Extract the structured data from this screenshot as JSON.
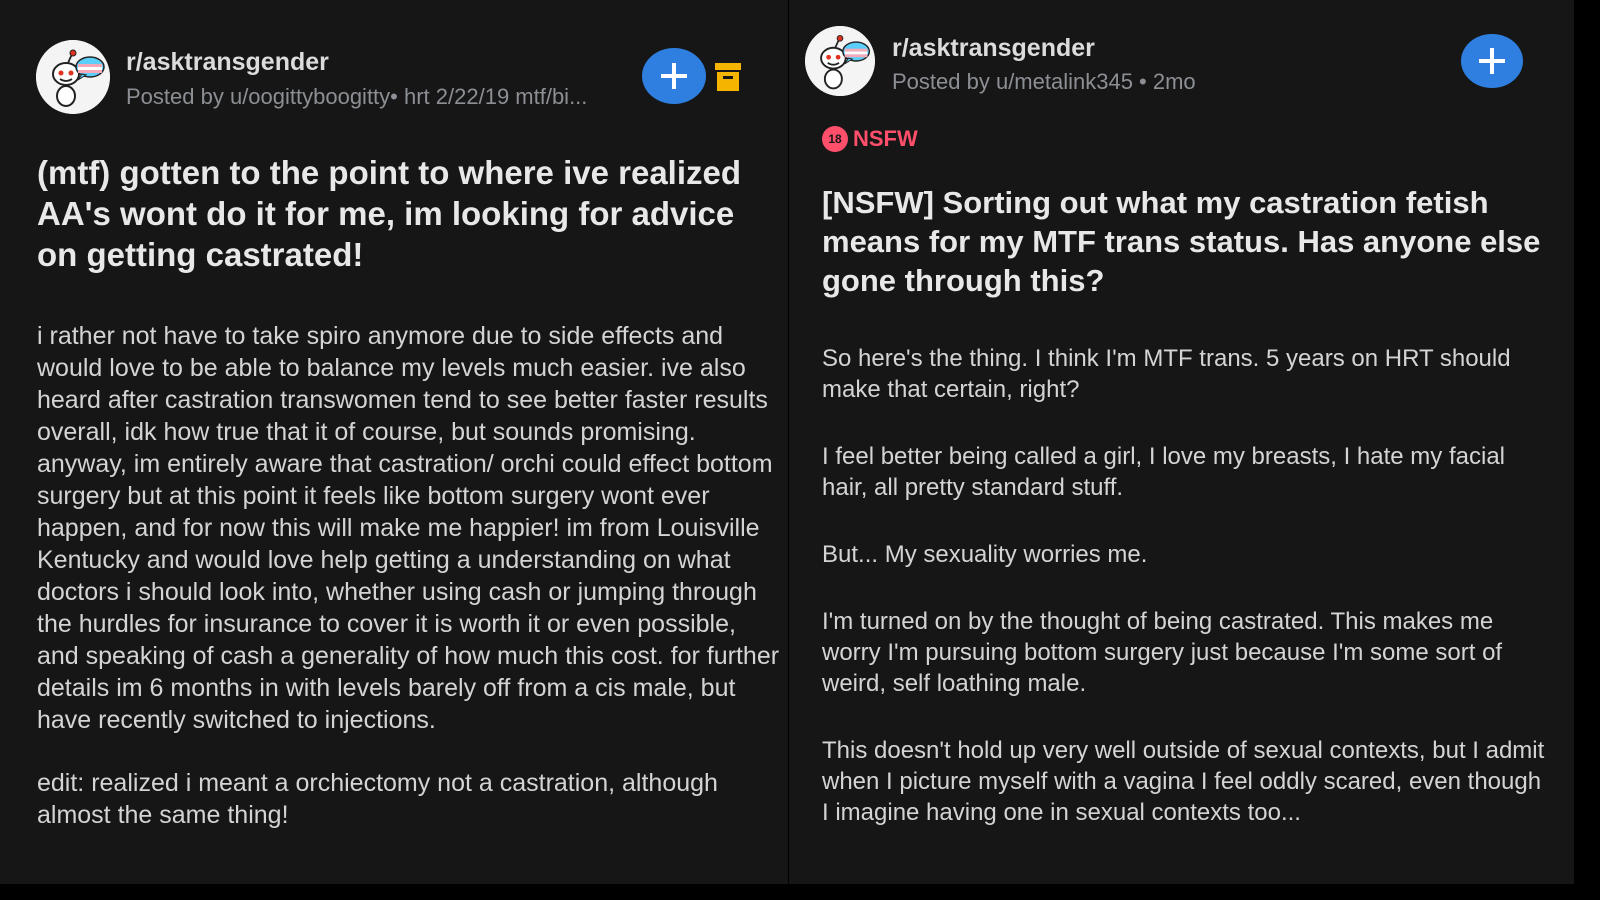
{
  "left_post": {
    "subreddit": "r/asktransgender",
    "meta": "Posted by u/oogittyboogitty• hrt 2/22/19 mtf/bi...",
    "title": "(mtf) gotten to the point to where ive realized AA's wont do it for me, im looking for advice on getting castrated!",
    "body": [
      "i rather not have to take spiro anymore due to side effects and would love to be able to balance my levels much easier. ive also heard after castration transwomen tend to see better faster results overall, idk how true that it of course, but sounds promising. anyway, im entirely aware that castration/ orchi could effect bottom surgery but at this point it feels like bottom surgery wont ever happen, and for now this will make me happier! im from Louisville Kentucky and would love help getting a understanding on what doctors i should look into, whether using cash or jumping through the hurdles for insurance to cover it is worth it or even possible, and speaking of cash a generality of how much this cost. for further details im 6 months in with levels barely off from a cis male, but have recently switched to injections.",
      "edit: realized i meant a orchiectomy not a castration, although almost the same thing!"
    ]
  },
  "right_post": {
    "subreddit": "r/asktransgender",
    "meta": "Posted by u/metalink345 • 2mo",
    "nsfw_badge": "18",
    "nsfw_label": "NSFW",
    "title": "[NSFW] Sorting out what my castration fetish means for my MTF trans status. Has anyone else gone through this?",
    "body": [
      "So here's the thing. I think I'm MTF trans. 5 years on HRT should make that certain, right?",
      "I feel better being called a girl, I love my breasts, I hate my facial hair, all pretty standard stuff.",
      "But... My sexuality worries me.",
      "I'm turned on by the thought of being castrated. This makes me worry I'm pursuing bottom surgery just because I'm some sort of weird, self loathing male.",
      "This doesn't hold up very well outside of sexual contexts, but I admit when I picture myself with a vagina I feel oddly scared, even though I imagine having one in sexual contexts too..."
    ]
  },
  "icons": {
    "join": "plus-icon",
    "archive": "archive-icon",
    "avatar": "snoo-avatar",
    "nsfw": "nsfw-18-icon"
  },
  "colors": {
    "background": "#161617",
    "accent_blue": "#2f7fe0",
    "archive_yellow": "#f5b400",
    "nsfw_red": "#ff4f6b",
    "title_text": "#e8e8e8",
    "meta_text": "#8c8f93"
  }
}
